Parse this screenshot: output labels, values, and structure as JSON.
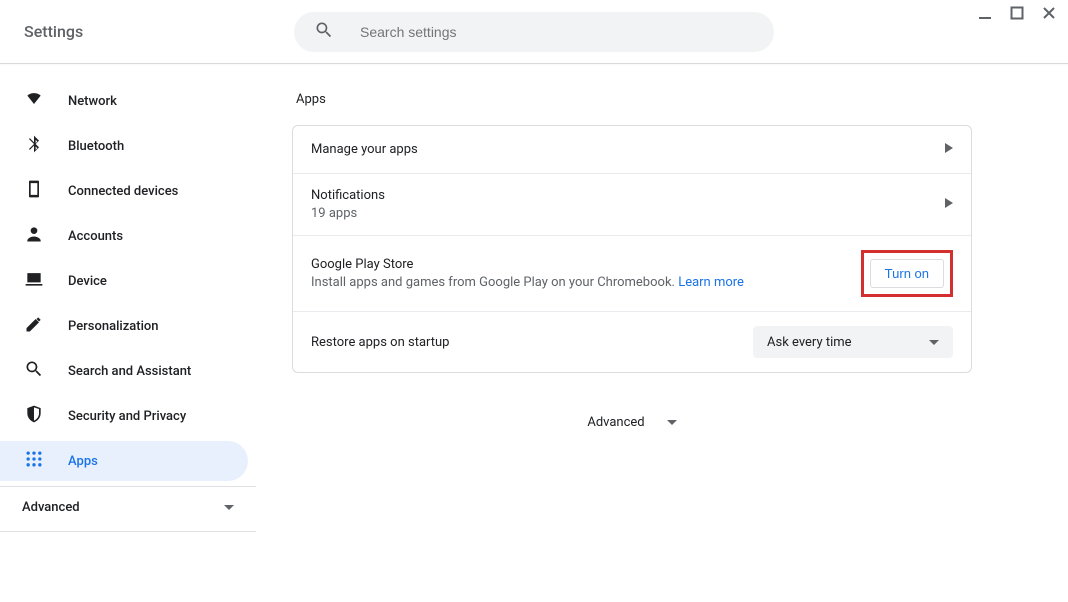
{
  "window": {
    "minimize": "minimize",
    "maximize": "maximize",
    "close": "close"
  },
  "header": {
    "title": "Settings",
    "search_placeholder": "Search settings"
  },
  "sidebar": {
    "items": [
      {
        "label": "Network"
      },
      {
        "label": "Bluetooth"
      },
      {
        "label": "Connected devices"
      },
      {
        "label": "Accounts"
      },
      {
        "label": "Device"
      },
      {
        "label": "Personalization"
      },
      {
        "label": "Search and Assistant"
      },
      {
        "label": "Security and Privacy"
      },
      {
        "label": "Apps"
      }
    ],
    "advanced_label": "Advanced"
  },
  "main": {
    "section_title": "Apps",
    "rows": {
      "manage": {
        "title": "Manage your apps"
      },
      "notifications": {
        "title": "Notifications",
        "sub": "19 apps"
      },
      "play": {
        "title": "Google Play Store",
        "sub_prefix": "Install apps and games from Google Play on your Chromebook. ",
        "learn_more": "Learn more",
        "button": "Turn on"
      },
      "restore": {
        "title": "Restore apps on startup",
        "selected": "Ask every time"
      }
    },
    "advanced_label": "Advanced"
  }
}
